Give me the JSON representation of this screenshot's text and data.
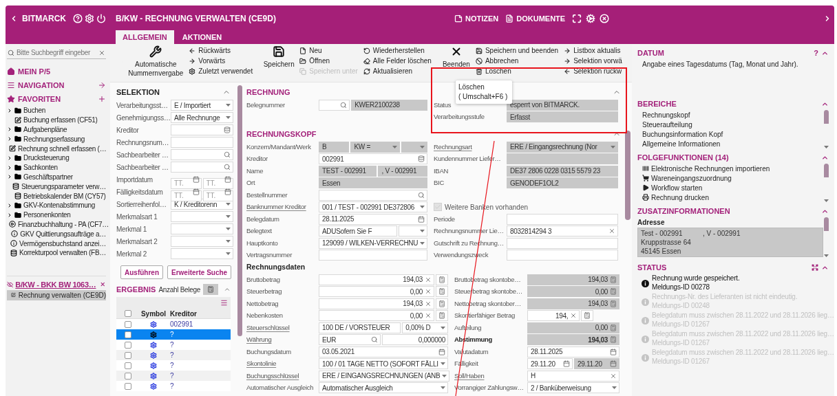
{
  "header": {
    "app": "BITMARCK",
    "title": "B/KW - RECHNUNG VERWALTEN (CE9D)",
    "actions": [
      "NOTIZEN",
      "DOKUMENTE"
    ]
  },
  "tabs": [
    {
      "label": "ALLGEMEIN",
      "selected": true
    },
    {
      "label": "AKTIONEN",
      "selected": false
    }
  ],
  "sidebar": {
    "search": {
      "placeholder": "Bitte Suchbegriff eingeber"
    },
    "sections": [
      "MEIN P/5",
      "NAVIGATION",
      "FAVORITEN"
    ],
    "favorites": [
      {
        "kind": "folder",
        "label": "Buchen",
        "expanded": false
      },
      {
        "kind": "edit",
        "label": "Buchung erfassen (CF51)"
      },
      {
        "kind": "folder",
        "label": "Aufgabenpläne",
        "expanded": false
      },
      {
        "kind": "folder",
        "label": "Rechnungserfassung",
        "expanded": false
      },
      {
        "kind": "edit",
        "label": "Rechnung schnell erfassen (…"
      },
      {
        "kind": "folder",
        "label": "Drucksteuerung",
        "expanded": false
      },
      {
        "kind": "folder",
        "label": "Sachkonten",
        "expanded": false
      },
      {
        "kind": "folder",
        "label": "Geschäftspartner",
        "expanded": false
      },
      {
        "kind": "database",
        "label": "Steuerungsparameter verw…"
      },
      {
        "kind": "database",
        "label": "Betriebskalender BM (CY57)"
      },
      {
        "kind": "folder",
        "label": "GKV-Kontenabstimmung",
        "expanded": false
      },
      {
        "kind": "folder",
        "label": "Personenkonten",
        "expanded": false
      },
      {
        "kind": "play",
        "label": "Finanzbuchhaltung - PA (CF7…"
      },
      {
        "kind": "info",
        "label": "GKV Quittierungsaufträge a…"
      },
      {
        "kind": "info",
        "label": "Vermögensbuchstand anzei…"
      },
      {
        "kind": "database",
        "label": "Korrekturpool verwalten (FB…"
      }
    ],
    "session": {
      "title": "B/KW - BKK BW 1063…",
      "items": [
        {
          "label": "Rechnung verwalten (CE9D)",
          "selected": true
        }
      ]
    }
  },
  "toolbar": {
    "groups": [
      {
        "button": "Automatische Nummernvergabe",
        "columns": [
          [
            {
              "label": "Rückwärts",
              "disabled": false
            },
            {
              "label": "Vorwärts",
              "disabled": false
            },
            {
              "label": "Zuletzt verwendet",
              "disabled": false
            }
          ]
        ]
      },
      {
        "button": "Speichern",
        "columns": [
          [
            {
              "label": "Neu",
              "disabled": false
            },
            {
              "label": "Öffnen",
              "disabled": false
            },
            {
              "label": "Speichern unter",
              "disabled": true
            }
          ],
          [
            {
              "label": "Wiederherstellen",
              "disabled": false
            },
            {
              "label": "Alle Felder löschen",
              "disabled": false
            },
            {
              "label": "Aktualisieren",
              "disabled": false
            }
          ]
        ]
      },
      {
        "button": "Beenden",
        "columns": [
          [
            {
              "label": "Speichern und beenden",
              "disabled": false
            },
            {
              "label": "Abbrechen",
              "disabled": false
            },
            {
              "label": "Löschen",
              "disabled": false
            }
          ],
          [
            {
              "label": "Listbox aktualis",
              "disabled": false
            },
            {
              "label": "Selektion vorwä",
              "disabled": false
            },
            {
              "label": "Selektion rückw",
              "disabled": false
            }
          ]
        ]
      }
    ]
  },
  "tooltip": {
    "title": "Löschen",
    "shortcut": "( Umschalt+F6 )"
  },
  "selektion": {
    "title": "SELEKTION",
    "fields": [
      {
        "label": "Verarbeitungsst…",
        "parts": [
          {
            "kind": "select",
            "value": "E / Importiert"
          }
        ]
      },
      {
        "label": "Genehmigungss…",
        "parts": [
          {
            "kind": "select",
            "value": "Alle Rechnunge"
          }
        ]
      },
      {
        "label": "Kreditor",
        "parts": [
          {
            "kind": "lookup"
          }
        ]
      },
      {
        "label": "Rechnungsnum…",
        "parts": [
          {
            "kind": "input"
          }
        ]
      },
      {
        "label": "Sachbearbeiter …",
        "parts": [
          {
            "kind": "search"
          }
        ]
      },
      {
        "label": "Sachbearbeiter …",
        "parts": [
          {
            "kind": "search"
          }
        ]
      },
      {
        "label": "Importdatum",
        "parts": [
          {
            "kind": "date",
            "placeholder": "TT."
          },
          {
            "kind": "date",
            "placeholder": "TT."
          }
        ]
      },
      {
        "label": "Fälligkeitsdatum",
        "parts": [
          {
            "kind": "date",
            "placeholder": "TT."
          },
          {
            "kind": "date",
            "placeholder": "TT."
          }
        ]
      },
      {
        "label": "Sortierreihenfol…",
        "parts": [
          {
            "kind": "select",
            "value": "K / Kreditorenn"
          }
        ]
      },
      {
        "label": "Merkmalsart 1",
        "parts": [
          {
            "kind": "select"
          }
        ]
      },
      {
        "label": "Merkmal 1",
        "parts": [
          {
            "kind": "select"
          }
        ]
      },
      {
        "label": "Merkmalsart 2",
        "parts": [
          {
            "kind": "select"
          }
        ]
      },
      {
        "label": "Merkmal 2",
        "parts": [
          {
            "kind": "select"
          }
        ]
      }
    ],
    "buttons": [
      "Ausführen",
      "Erweiterte Suche"
    ]
  },
  "ergebnis": {
    "title": "ERGEBNIS",
    "subtitle": "Anzahl Belege",
    "all_checked": false,
    "columns": [
      "Symbol",
      "Kreditor"
    ],
    "rows": [
      {
        "kreditor": "002991",
        "selected": false,
        "checked": false
      },
      {
        "kreditor": "?",
        "selected": true,
        "checked": false
      },
      {
        "kreditor": "?",
        "selected": false,
        "checked": false
      },
      {
        "kreditor": "?",
        "selected": false,
        "checked": false
      },
      {
        "kreditor": "?",
        "selected": false,
        "checked": false
      },
      {
        "kreditor": "?",
        "selected": false,
        "checked": false
      },
      {
        "kreditor": "?",
        "selected": false,
        "checked": false
      }
    ]
  },
  "form": {
    "sections": [
      {
        "kind": "upper",
        "title": "RECHNUNG",
        "rows": [
          {
            "left": {
              "label": "Belegnummer",
              "link": false,
              "parts": [
                {
                  "kind": "search"
                },
                {
                  "kind": "readonly",
                  "value": "KWER2100238"
                }
              ]
            },
            "right": {
              "label": "Status",
              "link": false,
              "parts": [
                {
                  "kind": "readonly",
                  "value": "esperrt von BITMARCK."
                }
              ]
            }
          },
          {
            "right": {
              "label": "Verarbeitungsstufe",
              "link": false,
              "parts": [
                {
                  "kind": "readonly",
                  "value": "Erfasst"
                }
              ]
            }
          }
        ]
      },
      {
        "kind": "upper",
        "title": "RECHNUNGSKOPF",
        "rows": [
          {
            "left": {
              "label": "Konzern/Mandant/Werk",
              "link": false,
              "parts": [
                {
                  "kind": "readonly",
                  "value": "B"
                },
                {
                  "kind": "readonly-select",
                  "value": "KW ="
                },
                {
                  "kind": "readonly-select"
                }
              ]
            },
            "right": {
              "label": "Rechnungsart",
              "link": true,
              "parts": [
                {
                  "kind": "readonly-select",
                  "value": "ERE / Eingangsrechnung (Nor"
                }
              ]
            }
          },
          {
            "left": {
              "label": "Kreditor",
              "link": false,
              "parts": [
                {
                  "kind": "lookup",
                  "value": "002991"
                }
              ]
            },
            "right": {
              "label": "Kundennummer Liefer…",
              "link": false,
              "parts": [
                {
                  "kind": "readonly"
                }
              ]
            }
          },
          {
            "left": {
              "label": "Name",
              "link": false,
              "parts": [
                {
                  "kind": "readonly",
                  "value": "TEST - 002991"
                },
                {
                  "kind": "readonly",
                  "value": ", V - 002991"
                }
              ]
            },
            "right": {
              "label": "IBAN",
              "link": false,
              "parts": [
                {
                  "kind": "readonly",
                  "value": "DE37 2806 0228 0315 5579 23"
                }
              ]
            }
          },
          {
            "left": {
              "label": "Ort",
              "link": false,
              "parts": [
                {
                  "kind": "readonly",
                  "value": "Essen"
                }
              ]
            },
            "right": {
              "label": "BIC",
              "link": false,
              "parts": [
                {
                  "kind": "readonly",
                  "value": "GENODEF1OL2"
                }
              ]
            }
          },
          {
            "left": {
              "label": "Bestellnummer",
              "link": false,
              "parts": [
                {
                  "kind": "search"
                }
              ]
            }
          },
          {
            "left": {
              "label": "Banknummer Kreditor",
              "link": true,
              "parts": [
                {
                  "kind": "select",
                  "value": "001 / TEST - 002991 DE372806"
                }
              ]
            },
            "right": {
              "kind": "checkbox",
              "label": "Weitere Banken vorhanden",
              "checked": true,
              "disabled": true
            }
          },
          {
            "left": {
              "label": "Belegdatum",
              "link": false,
              "parts": [
                {
                  "kind": "date",
                  "value": "28.11.2025"
                }
              ]
            },
            "right": {
              "label": "Periode",
              "link": false,
              "parts": [
                {
                  "kind": "input"
                }
              ]
            }
          },
          {
            "left": {
              "label": "Belegtext",
              "link": false,
              "parts": [
                {
                  "kind": "input",
                  "value": "ADUSofern Sie F"
                },
                {
                  "kind": "select"
                }
              ]
            },
            "right": {
              "label": "Rechnungsnummer Lie…",
              "link": false,
              "parts": [
                {
                  "kind": "clearable",
                  "value": "8032814294 3"
                }
              ]
            }
          },
          {
            "left": {
              "label": "Hauptkonto",
              "link": false,
              "parts": [
                {
                  "kind": "select",
                  "value": "129099 / WILKEN-VERRECHNU"
                }
              ]
            },
            "right": {
              "label": "Gutschrift zu Rechnung…",
              "link": false,
              "parts": [
                {
                  "kind": "input"
                }
              ]
            }
          },
          {
            "left": {
              "label": "Vertragsnummer",
              "link": false,
              "parts": [
                {
                  "kind": "input"
                }
              ]
            },
            "right": {
              "label": "Verwendungszweck",
              "link": false,
              "parts": [
                {
                  "kind": "input"
                }
              ]
            }
          }
        ]
      },
      {
        "kind": "lower",
        "subtitle": "Rechnungsdaten",
        "rows": [
          {
            "left": {
              "label": "Bruttobetrag",
              "link": false,
              "parts": [
                {
                  "kind": "amount",
                  "value": "194,03"
                }
              ]
            },
            "right": {
              "label": "Bruttobetrag skontobe…",
              "link": false,
              "parts": [
                {
                  "kind": "calc",
                  "value": "194,03"
                }
              ]
            }
          },
          {
            "left": {
              "label": "Steuerbetrag",
              "link": false,
              "parts": [
                {
                  "kind": "amount",
                  "value": "0,00"
                }
              ]
            },
            "right": {
              "label": "Steuerbetrag skontobe…",
              "link": false,
              "parts": [
                {
                  "kind": "calc",
                  "value": "0,00"
                }
              ]
            }
          },
          {
            "left": {
              "label": "Nettobetrag",
              "link": false,
              "parts": [
                {
                  "kind": "amount",
                  "value": "194,03"
                }
              ]
            },
            "right": {
              "label": "Nettobetrag skontober…",
              "link": false,
              "parts": [
                {
                  "kind": "calc",
                  "value": "194,03"
                }
              ]
            }
          },
          {
            "left": {
              "label": "Nebenkosten",
              "link": false,
              "parts": [
                {
                  "kind": "amount",
                  "value": "0,00"
                }
              ]
            },
            "right": {
              "label": "Skontierfähiger Betrag",
              "link": false,
              "parts": [
                {
                  "kind": "amount",
                  "value": "194,"
                },
                {
                  "kind": "spacer"
                }
              ]
            }
          },
          {
            "left": {
              "label": "Steuerschlüssel",
              "link": true,
              "parts": [
                {
                  "kind": "input",
                  "value": "100 DE / VORSTEUER"
                },
                {
                  "kind": "select",
                  "value": "0,00% D"
                }
              ]
            },
            "right": {
              "label": "Aufteilung",
              "link": false,
              "parts": [
                {
                  "kind": "calc",
                  "value": "0,00"
                }
              ]
            }
          },
          {
            "left": {
              "label": "Währung",
              "link": true,
              "parts": [
                {
                  "kind": "search",
                  "value": "EUR"
                },
                {
                  "kind": "number",
                  "value": "0,000000"
                }
              ]
            },
            "right": {
              "label": "Abstimmung",
              "link": false,
              "emphasis": true,
              "parts": [
                {
                  "kind": "calc",
                  "value": "194,03"
                }
              ]
            }
          },
          {
            "left": {
              "label": "Buchungsdatum",
              "link": false,
              "parts": [
                {
                  "kind": "date",
                  "value": "03.05.2021"
                }
              ]
            },
            "right": {
              "label": "Valutadatum",
              "link": false,
              "parts": [
                {
                  "kind": "date",
                  "value": "28.11.2025"
                }
              ]
            }
          },
          {
            "left": {
              "label": "Skontolinie",
              "link": true,
              "parts": [
                {
                  "kind": "select",
                  "value": "100 / 01 TAGE NETTO (SOFORT FÄLLI"
                }
              ]
            },
            "right": {
              "label": "Fälligkeit",
              "link": false,
              "parts": [
                {
                  "kind": "date",
                  "value": "29.11.20"
                },
                {
                  "kind": "readonly-date",
                  "value": "29.11.20"
                }
              ]
            }
          },
          {
            "left": {
              "label": "Buchungsschlüssel",
              "link": true,
              "parts": [
                {
                  "kind": "select",
                  "value": "ERE / EINGANGSRECHNUNGEN (ANB"
                }
              ]
            },
            "right": {
              "label": "Soll/Haben",
              "link": true,
              "parts": [
                {
                  "kind": "clearable",
                  "value": "H"
                }
              ]
            }
          },
          {
            "left": {
              "label": "Automatischer Ausgleich",
              "link": false,
              "parts": [
                {
                  "kind": "select",
                  "value": "Automatischer Ausgleich"
                }
              ]
            },
            "right": {
              "label": "Vorrangiger Zahlungsw…",
              "link": false,
              "parts": [
                {
                  "kind": "select",
                  "value": "2 / Banküberweisung"
                }
              ]
            }
          }
        ]
      }
    ]
  },
  "info_panel": {
    "datum": {
      "title": "DATUM",
      "help": "?",
      "text": "Angabe eines Tagesdatums (Tag, Monat und Jahr)."
    },
    "bereiche": {
      "title": "BEREICHE",
      "items": [
        "Rechnungskopf",
        "Steueraufteilung",
        "Buchungsinformation Kopf",
        "Allgemeine Informationen"
      ]
    },
    "folgefunktionen": {
      "title": "FOLGEFUNKTIONEN (14)",
      "items": [
        "Elektronische Rechnungen importieren",
        "Wareneingangszuordnung",
        "Workflow starten",
        "Rechnung drucken"
      ]
    },
    "zusatz": {
      "title": "ZUSATZINFORMATIONEN",
      "label": "Adresse",
      "name_parts": [
        "Test - 002991",
        ", V - 002991"
      ],
      "lines": [
        "Kruppstrasse 64",
        "45145 Essen"
      ]
    },
    "status": {
      "title": "STATUS",
      "messages": [
        {
          "text": "Rechnung wurde gespeichert.",
          "id": "Meldungs-ID 00278",
          "dimmed": false
        },
        {
          "text": "Rechnungs-Nr. des Lieferanten ist nicht eindeutig.",
          "id": "Meldungs-ID 00248",
          "dimmed": true
        },
        {
          "text": "Belegdatum muss zwischen 28.11.2022 und 28.11.2026 lieg…",
          "id": "Meldungs-ID 01267",
          "dimmed": true
        },
        {
          "text": "Belegdatum muss zwischen 28.11.2022 und 28.11.2026 lieg…",
          "id": "Meldungs-ID 01267",
          "dimmed": true
        },
        {
          "text": "Belegdatum muss zwischen 28.11.2022 und 28.11.2026 lieg…",
          "id": "Meldungs-ID 01267",
          "dimmed": true
        }
      ]
    }
  }
}
